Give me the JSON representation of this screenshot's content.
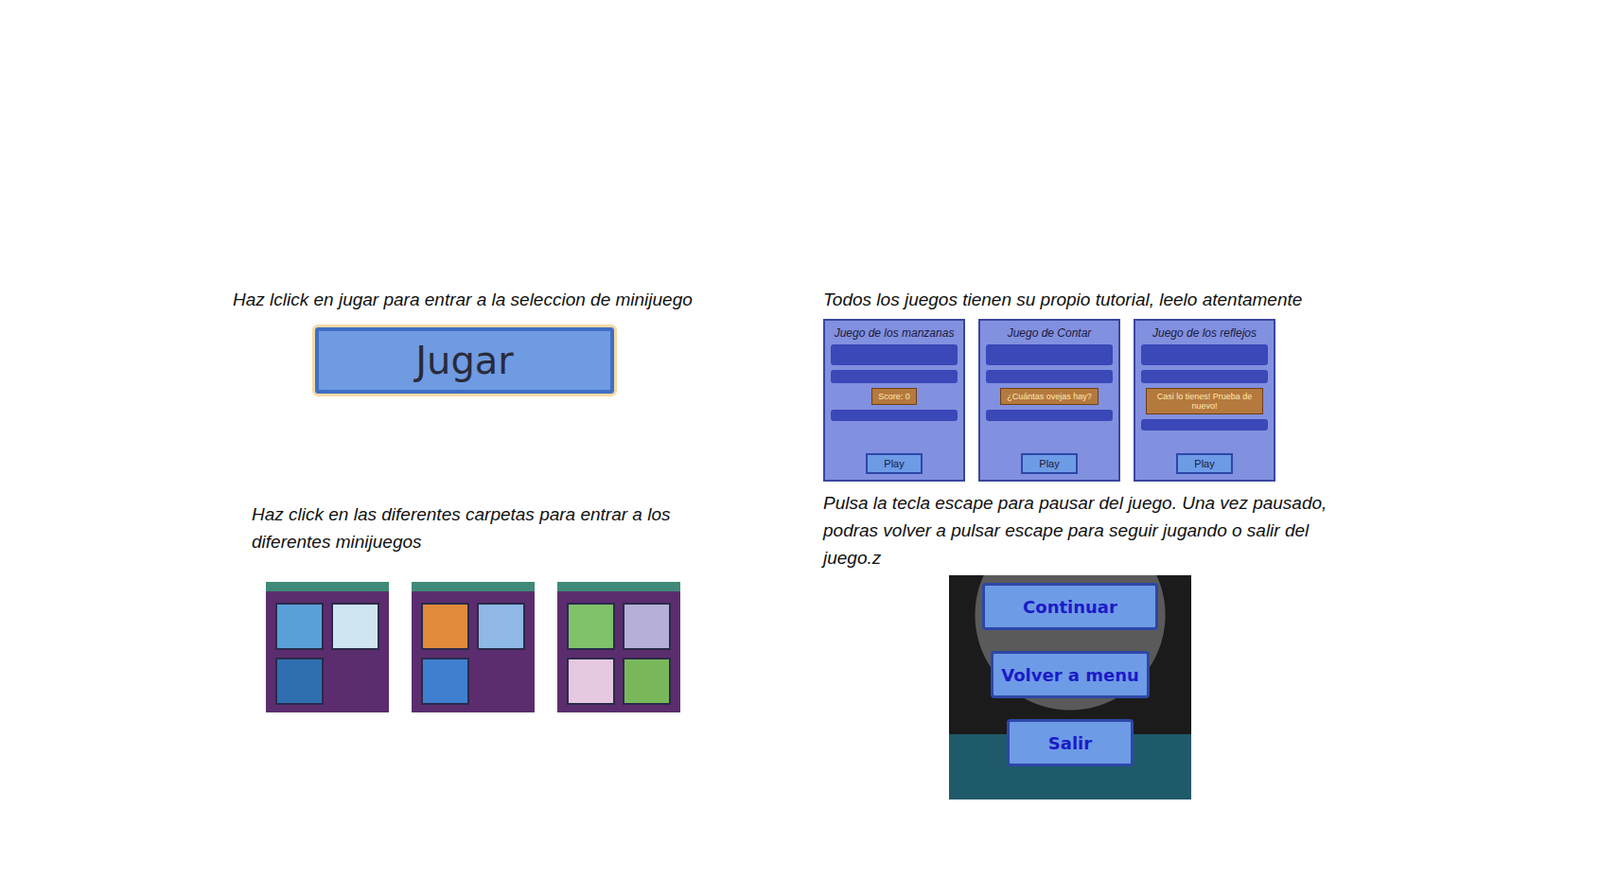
{
  "menu": {
    "play_hint": "Haz lclick en jugar para entrar a la seleccion de minijuego",
    "play_button": "Jugar",
    "folders_hint": "Haz click en las diferentes carpetas para entrar a los diferentes minijuegos",
    "folders": [
      {
        "thumbnails": [
          {
            "color": "#5aa0d8"
          },
          {
            "color": "#cfe6f2"
          },
          {
            "color": "#2f6fb0"
          }
        ]
      },
      {
        "thumbnails": [
          {
            "color": "#e08a3c"
          },
          {
            "color": "#8fb8e6"
          },
          {
            "color": "#3f7fd0"
          }
        ]
      },
      {
        "thumbnails": [
          {
            "color": "#7fc26a"
          },
          {
            "color": "#b6b0d8"
          },
          {
            "color": "#e6c8e0"
          },
          {
            "color": "#79b85a"
          }
        ]
      }
    ]
  },
  "tutorials": {
    "hint": "Todos los juegos tienen su propio tutorial, leelo atentamente",
    "cards": [
      {
        "title": "Juego de los manzanas",
        "extra": "Score: 0",
        "play": "Play"
      },
      {
        "title": "Juego de Contar",
        "extra": "¿Cuántas ovejas hay?",
        "play": "Play"
      },
      {
        "title": "Juego de los reflejos",
        "extra": "Casi lo tienes! Prueba de nuevo!",
        "play": "Play"
      }
    ]
  },
  "pause": {
    "hint": "Pulsa la tecla escape para pausar del juego. Una vez pausado, podras volver a pulsar escape para seguir jugando o salir del juego.z",
    "buttons": [
      "Continuar",
      "Volver a menu",
      "Salir"
    ]
  }
}
